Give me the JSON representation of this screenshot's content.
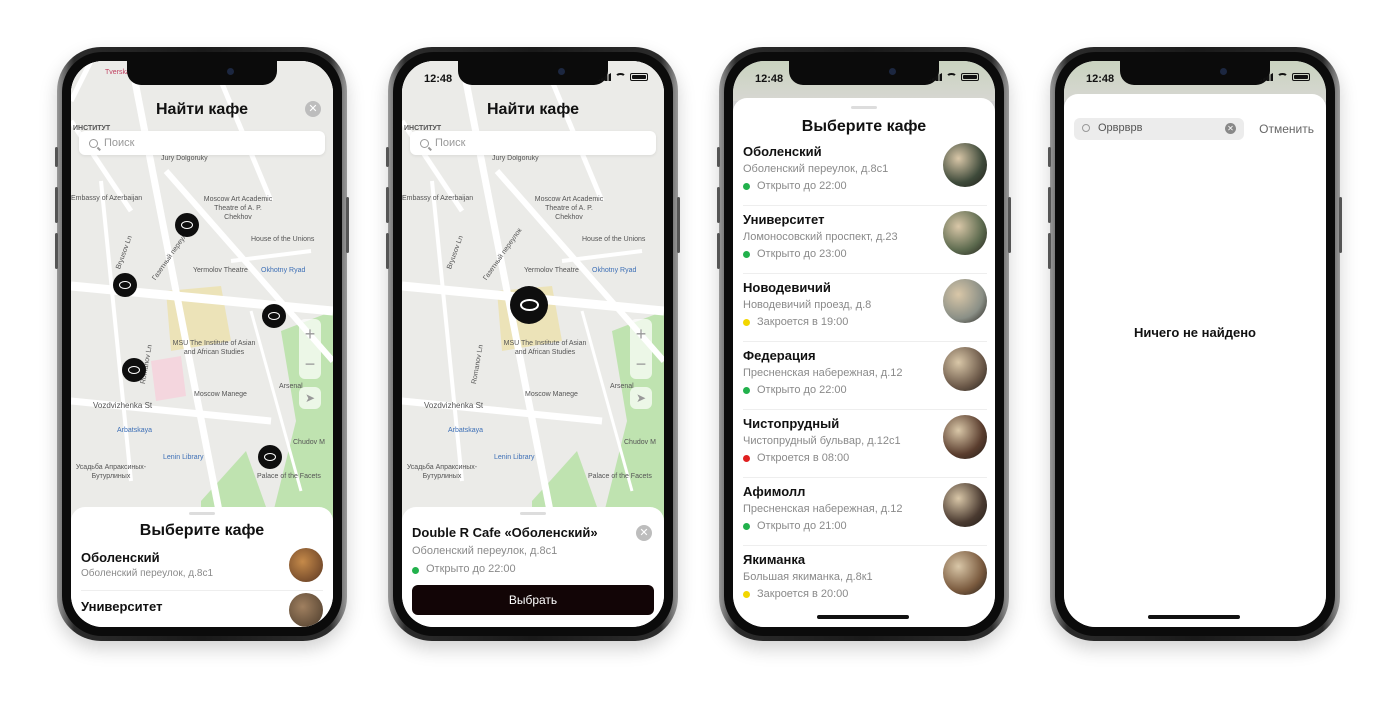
{
  "status": {
    "time": "12:48"
  },
  "screen1": {
    "title": "Найти кафе",
    "search_placeholder": "Поиск",
    "sheet_title": "Выберите кафе",
    "cafes": [
      {
        "name": "Оболенский",
        "address": "Оболенский переулок, д.8с1"
      },
      {
        "name": "Университет",
        "address": ""
      }
    ]
  },
  "screen2": {
    "title": "Найти кафе",
    "search_placeholder": "Поиск",
    "cafe_name": "Double R Cafe «Оболенский»",
    "cafe_address": "Оболенский переулок, д.8с1",
    "cafe_status": "Открыто до 22:00",
    "select_button": "Выбрать"
  },
  "screen3": {
    "title": "Выберите кафе",
    "cafes": [
      {
        "name": "Оболенский",
        "address": "Оболенский переулок, д.8с1",
        "status": "Открыто до 22:00",
        "status_color": "#22b14c",
        "photo_color": "#3e4a3a"
      },
      {
        "name": "Университет",
        "address": "Ломоносовский проспект, д.23",
        "status": "Открыто до 23:00",
        "status_color": "#22b14c",
        "photo_color": "#5c6a4e"
      },
      {
        "name": "Новодевичий",
        "address": "Новодевичий проезд, д.8",
        "status": "Закроется в 19:00",
        "status_color": "#f2d600",
        "photo_color": "#8a8f86"
      },
      {
        "name": "Федерация",
        "address": "Пресненская набережная, д.12",
        "status": "Открыто до 22:00",
        "status_color": "#22b14c",
        "photo_color": "#6d5a4a"
      },
      {
        "name": "Чистопрудный",
        "address": "Чистопрудный бульвар, д.12с1",
        "status": "Откроется в 08:00",
        "status_color": "#e02020",
        "photo_color": "#5a3d2e"
      },
      {
        "name": "Афимолл",
        "address": "Пресненская набережная, д.12",
        "status": "Открыто до 21:00",
        "status_color": "#22b14c",
        "photo_color": "#4a3a30"
      },
      {
        "name": "Якиманка",
        "address": "Большая якиманка, д.8к1",
        "status": "Закроется в 20:00",
        "status_color": "#f2d600",
        "photo_color": "#7a5a3e"
      }
    ]
  },
  "screen4": {
    "search_value": "Орврврв",
    "cancel": "Отменить",
    "empty": "Ничего не найдено"
  },
  "map_labels": {
    "tverskaya": "Tverska",
    "institute": "ИНСТИТУТ",
    "jury": "Jury Dolgoruky",
    "kamergersky": "Kamergersky ...",
    "azerbaijan": "Embassy of Azerbaijan",
    "theatre": "Moscow Art Academic Theatre of A. P. Chekhov",
    "unions": "House of the Unions",
    "bryusov": "Bryusov Ln",
    "gazetny": "Газетный переулок",
    "yermolov": "Yermolov Theatre",
    "okhotny": "Okhotny Ryad",
    "msu": "MSU The Institute of Asian and African Studies",
    "romanov": "Romanov Ln",
    "vozdvizhenka": "Vozdvizhenka St",
    "manege": "Moscow Manege",
    "arsenal": "Arsenal",
    "arbatskaya": "Arbatskaya",
    "lenin": "Lenin Library",
    "chudov": "Chudov M",
    "facets": "Palace of the Facets",
    "usadba": "Усадьба Апраксиных-Бутурлиных"
  }
}
